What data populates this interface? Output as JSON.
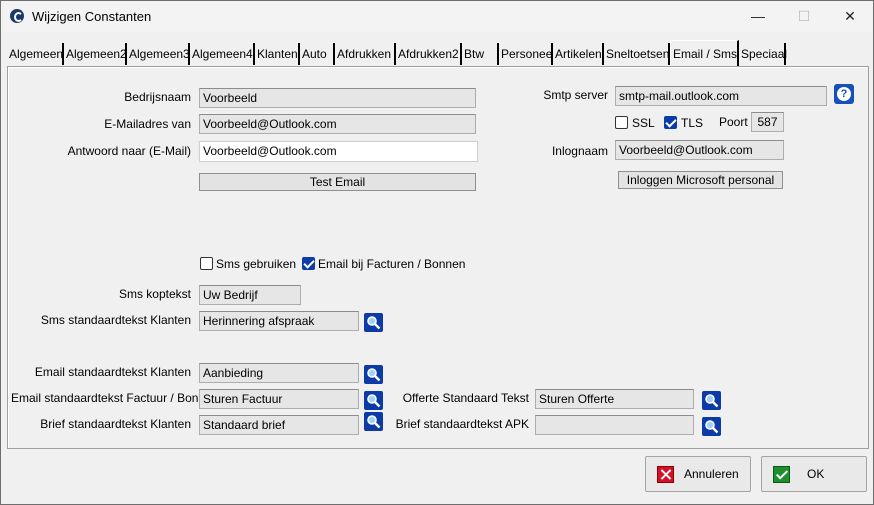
{
  "window": {
    "title": "Wijzigen Constanten",
    "minimize": "—",
    "maximize": "☐",
    "close": "✕"
  },
  "tabs": [
    "Algemeen",
    "Algemeen2",
    "Algemeen3",
    "Algemeen4",
    "Klanten",
    "Auto",
    "Afdrukken",
    "Afdrukken2",
    "Btw",
    "Personeel",
    "Artikelen",
    "Sneltoetsen",
    "Email / Sms",
    "Speciaal"
  ],
  "active_tab": "Email / Sms",
  "form": {
    "bedrijfsnaam": {
      "label": "Bedrijsnaam",
      "value": "Voorbeeld"
    },
    "emailadres": {
      "label": "E-Mailadres van",
      "value": "Voorbeeld@Outlook.com"
    },
    "antwoord": {
      "label": "Antwoord naar (E-Mail)",
      "value": "Voorbeeld@Outlook.com"
    },
    "test_email": "Test Email",
    "smtp": {
      "label": "Smtp server",
      "value": "smtp-mail.outlook.com"
    },
    "ssl": {
      "label": "SSL",
      "checked": false
    },
    "tls": {
      "label": "TLS",
      "checked": true
    },
    "poort": {
      "label": "Poort",
      "value": "587"
    },
    "inlognaam": {
      "label": "Inlognaam",
      "value": "Voorbeeld@Outlook.com"
    },
    "inloggen_ms": "Inloggen Microsoft personal",
    "sms_gebruiken": {
      "label": "Sms gebruiken",
      "checked": false
    },
    "email_facturen": {
      "label": "Email bij Facturen / Bonnen",
      "checked": true
    },
    "sms_koptekst": {
      "label": "Sms koptekst",
      "value": "Uw Bedrijf"
    },
    "sms_std_klanten": {
      "label": "Sms standaardtekst Klanten",
      "value": "Herinnering afspraak"
    },
    "email_std_klanten": {
      "label": "Email standaardtekst Klanten",
      "value": "Aanbieding"
    },
    "email_std_factuur": {
      "label": "Email standaardtekst Factuur / Bon",
      "value": "Sturen Factuur"
    },
    "brief_std_klanten": {
      "label": "Brief standaardtekst Klanten",
      "value": "Standaard brief"
    },
    "offerte_std": {
      "label": "Offerte Standaard Tekst",
      "value": "Sturen Offerte"
    },
    "brief_std_apk": {
      "label": "Brief standaardtekst APK",
      "value": ""
    }
  },
  "buttons": {
    "annuleren": "Annuleren",
    "ok": "OK"
  },
  "icons": {
    "search": "search-icon",
    "help": "help-icon",
    "cancel": "cancel-icon",
    "ok": "check-icon"
  }
}
